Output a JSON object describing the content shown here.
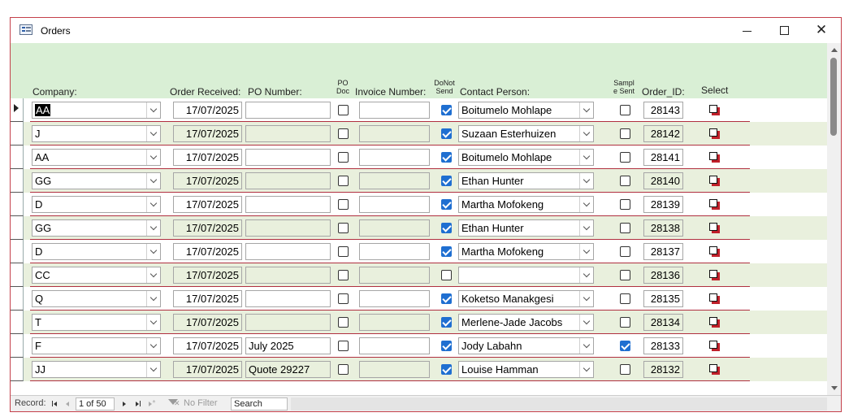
{
  "window": {
    "title": "Orders",
    "icon": "form-icon"
  },
  "headers": {
    "company": "Company:",
    "order_received": "Order Received:",
    "po_number": "PO Number:",
    "po_doc_1": "PO",
    "po_doc_2": "Doc",
    "invoice_number": "Invoice Number:",
    "donot_1": "DoNot",
    "donot_2": "Send",
    "contact_person": "Contact Person:",
    "sample_1": "Sampl",
    "sample_2": "e Sent",
    "order_id": "Order_ID:",
    "select": "Select"
  },
  "rows": [
    {
      "company": "AA",
      "order_received": "17/07/2025",
      "po_number": "",
      "po_doc": false,
      "invoice_number": "",
      "donot_send": true,
      "contact_person": "Boitumelo Mohlape",
      "sample_sent": false,
      "order_id": "28143",
      "current": true
    },
    {
      "company": "J",
      "order_received": "17/07/2025",
      "po_number": "",
      "po_doc": false,
      "invoice_number": "",
      "donot_send": true,
      "contact_person": "Suzaan Esterhuizen",
      "sample_sent": false,
      "order_id": "28142"
    },
    {
      "company": "AA",
      "order_received": "17/07/2025",
      "po_number": "",
      "po_doc": false,
      "invoice_number": "",
      "donot_send": true,
      "contact_person": "Boitumelo Mohlape",
      "sample_sent": false,
      "order_id": "28141"
    },
    {
      "company": "GG",
      "order_received": "17/07/2025",
      "po_number": "",
      "po_doc": false,
      "invoice_number": "",
      "donot_send": true,
      "contact_person": "Ethan Hunter",
      "sample_sent": false,
      "order_id": "28140"
    },
    {
      "company": "D",
      "order_received": "17/07/2025",
      "po_number": "",
      "po_doc": false,
      "invoice_number": "",
      "donot_send": true,
      "contact_person": "Martha Mofokeng",
      "sample_sent": false,
      "order_id": "28139"
    },
    {
      "company": "GG",
      "order_received": "17/07/2025",
      "po_number": "",
      "po_doc": false,
      "invoice_number": "",
      "donot_send": true,
      "contact_person": "Ethan Hunter",
      "sample_sent": false,
      "order_id": "28138"
    },
    {
      "company": "D",
      "order_received": "17/07/2025",
      "po_number": "",
      "po_doc": false,
      "invoice_number": "",
      "donot_send": true,
      "contact_person": "Martha Mofokeng",
      "sample_sent": false,
      "order_id": "28137"
    },
    {
      "company": "CC",
      "order_received": "17/07/2025",
      "po_number": "",
      "po_doc": false,
      "invoice_number": "",
      "donot_send": false,
      "contact_person": "",
      "sample_sent": false,
      "order_id": "28136"
    },
    {
      "company": "Q",
      "order_received": "17/07/2025",
      "po_number": "",
      "po_doc": false,
      "invoice_number": "",
      "donot_send": true,
      "contact_person": "Koketso Manakgesi",
      "sample_sent": false,
      "order_id": "28135"
    },
    {
      "company": "T",
      "order_received": "17/07/2025",
      "po_number": "",
      "po_doc": false,
      "invoice_number": "",
      "donot_send": true,
      "contact_person": "Merlene-Jade Jacobs",
      "sample_sent": false,
      "order_id": "28134"
    },
    {
      "company": "F",
      "order_received": "17/07/2025",
      "po_number": "July 2025",
      "po_doc": false,
      "invoice_number": "",
      "donot_send": true,
      "contact_person": "Jody Labahn",
      "sample_sent": true,
      "order_id": "28133"
    },
    {
      "company": "JJ",
      "order_received": "17/07/2025",
      "po_number": "Quote 29227",
      "po_doc": false,
      "invoice_number": "",
      "donot_send": true,
      "contact_person": "Louise Hamman",
      "sample_sent": false,
      "order_id": "28132"
    }
  ],
  "navigation": {
    "record_label": "Record:",
    "record_value": "1 of 50",
    "filter_label": "No Filter",
    "search_placeholder": "Search"
  },
  "colors": {
    "header_band": "#d9efd5",
    "alt_row": "#e9f0dd",
    "row_separator": "#b03040",
    "checkbox_on": "#1f6fd1",
    "window_border": "#c4404a"
  }
}
